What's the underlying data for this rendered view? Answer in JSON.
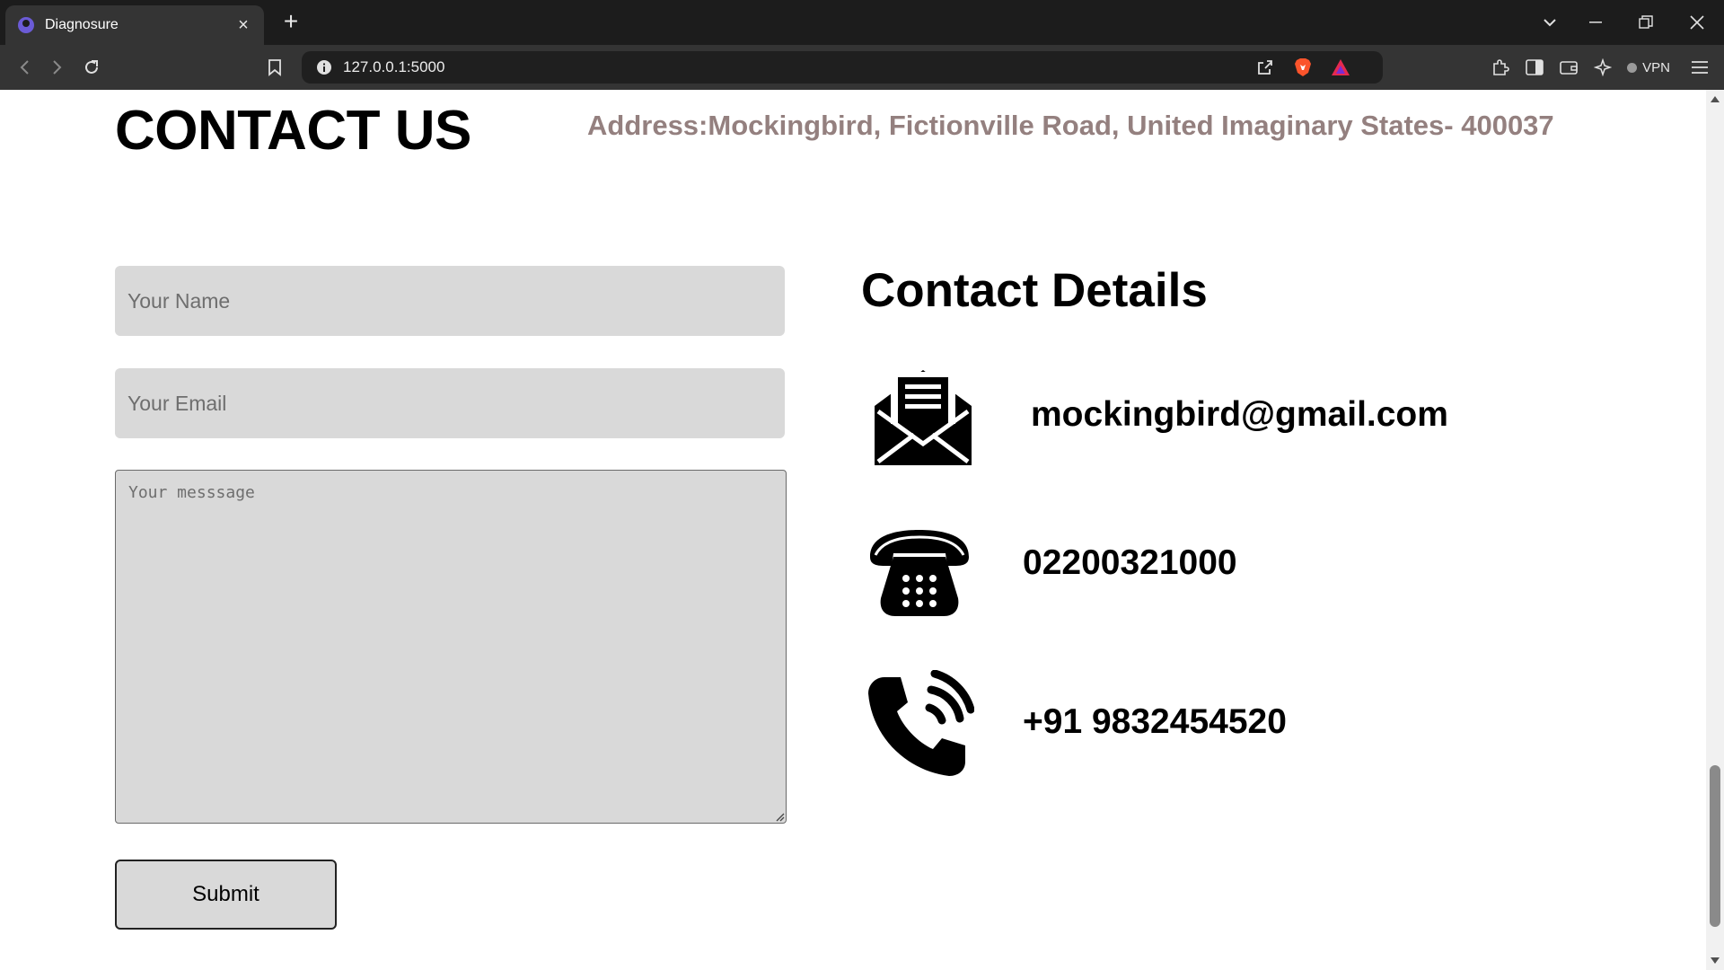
{
  "browser": {
    "tab_title": "Diagnosure",
    "tab_close": "×",
    "new_tab": "+",
    "url": "127.0.0.1:5000",
    "vpn_label": "VPN"
  },
  "page": {
    "heading": "CONTACT US",
    "address": "Address:Mockingbird, Fictionville Road, United Imaginary States- 400037"
  },
  "form": {
    "name_placeholder": "Your Name",
    "email_placeholder": "Your Email",
    "message_placeholder": "Your messsage",
    "submit_label": "Submit"
  },
  "contact": {
    "title": "Contact Details",
    "email": "mockingbird@gmail.com",
    "landline": "02200321000",
    "mobile": "+91 9832454520"
  },
  "colors": {
    "address_text": "#94807f",
    "field_bg": "#d9d9d9",
    "chrome_dark": "#1c1c1c",
    "chrome_toolbar": "#343434"
  }
}
